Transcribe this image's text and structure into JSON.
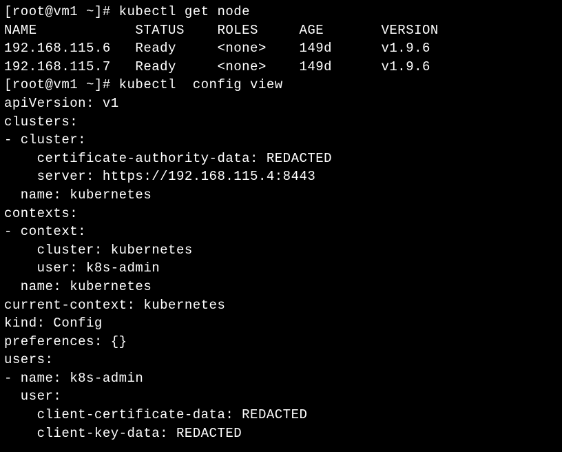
{
  "lines": [
    "[root@vm1 ~]# kubectl get node",
    "NAME            STATUS    ROLES     AGE       VERSION",
    "192.168.115.6   Ready     <none>    149d      v1.9.6",
    "192.168.115.7   Ready     <none>    149d      v1.9.6",
    "[root@vm1 ~]# kubectl  config view",
    "apiVersion: v1",
    "clusters:",
    "- cluster:",
    "    certificate-authority-data: REDACTED",
    "    server: https://192.168.115.4:8443",
    "  name: kubernetes",
    "contexts:",
    "- context:",
    "    cluster: kubernetes",
    "    user: k8s-admin",
    "  name: kubernetes",
    "current-context: kubernetes",
    "kind: Config",
    "preferences: {}",
    "users:",
    "- name: k8s-admin",
    "  user:",
    "    client-certificate-data: REDACTED",
    "    client-key-data: REDACTED"
  ]
}
